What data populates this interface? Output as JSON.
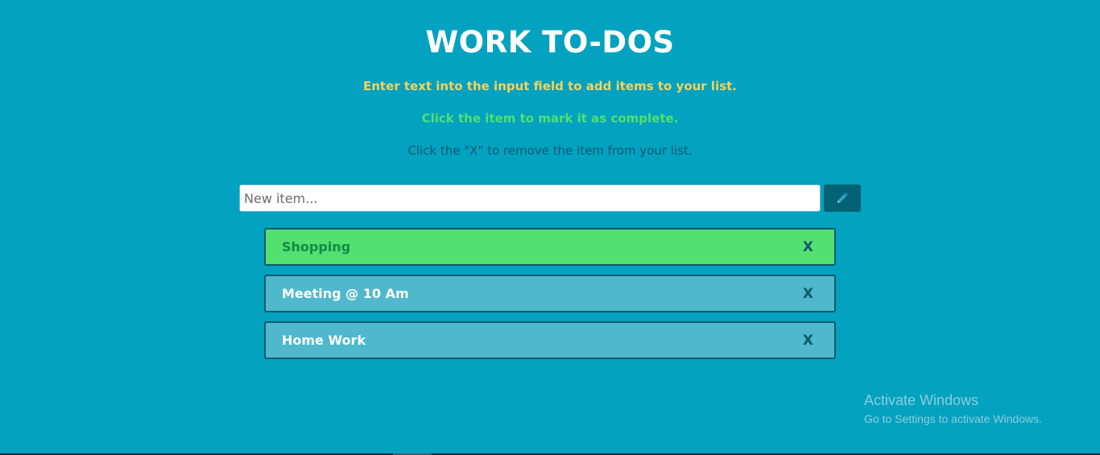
{
  "header": {
    "title": "WORK TO-DOS"
  },
  "instructions": {
    "add": "Enter text into the input field to add items to your list.",
    "complete": "Click the item to mark it as complete.",
    "remove": "Click the \"X\" to remove the item from your list."
  },
  "new_item": {
    "placeholder": "New item...",
    "value": ""
  },
  "add_button": {
    "icon": "pencil-icon"
  },
  "todos": [
    {
      "label": "Shopping",
      "completed": true,
      "remove_label": "X"
    },
    {
      "label": "Meeting @ 10 Am",
      "completed": false,
      "remove_label": "X"
    },
    {
      "label": "Home Work",
      "completed": false,
      "remove_label": "X"
    }
  ],
  "watermark": {
    "title": "Activate Windows",
    "subtitle": "Go to Settings to activate Windows."
  },
  "colors": {
    "background": "#02a2c0",
    "completed": "#52e070",
    "pending": "#4fb8cd",
    "accent_dark": "#036276",
    "instruction_yellow": "#f2d35e"
  }
}
